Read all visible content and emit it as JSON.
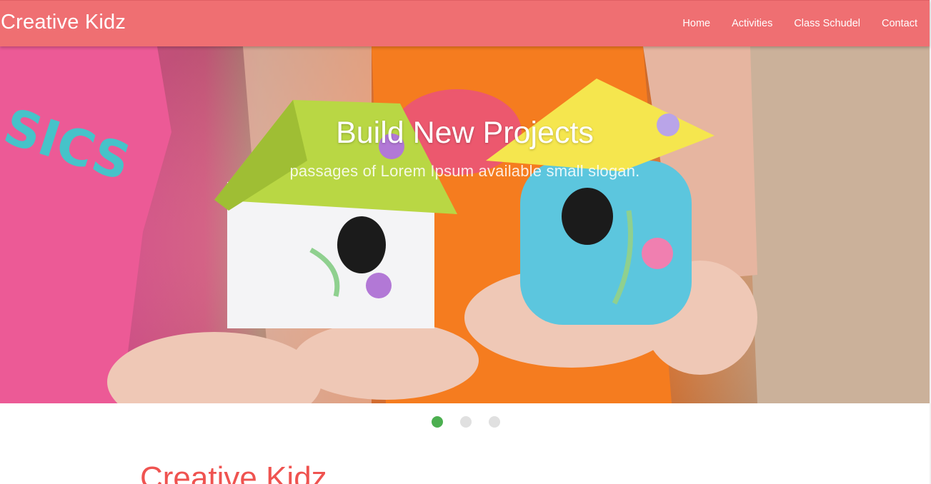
{
  "navbar": {
    "brand": "Creative Kidz",
    "links": [
      {
        "label": "Home"
      },
      {
        "label": "Activities"
      },
      {
        "label": "Class Schudel"
      },
      {
        "label": "Contact"
      }
    ],
    "background_color": "#ef6f72"
  },
  "hero": {
    "title": "Build New Projects",
    "subtitle": "passages of Lorem Ipsum available small slogan."
  },
  "slider": {
    "slide_count": 3,
    "active_index": 0,
    "active_color": "#4caf50",
    "inactive_color": "#e0e0e0"
  },
  "section": {
    "title": "Creative Kidz",
    "title_color": "#ef5350"
  }
}
